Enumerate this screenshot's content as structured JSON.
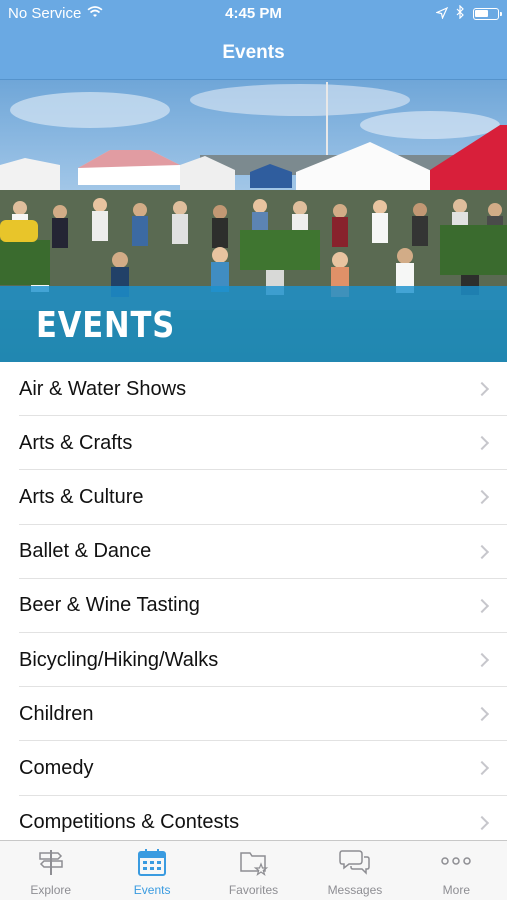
{
  "status_bar": {
    "carrier": "No Service",
    "time": "4:45 PM"
  },
  "nav": {
    "title": "Events"
  },
  "hero": {
    "title": "EVENTS"
  },
  "list": {
    "items": [
      {
        "label": "Air & Water Shows"
      },
      {
        "label": "Arts & Crafts"
      },
      {
        "label": "Arts & Culture"
      },
      {
        "label": "Ballet & Dance"
      },
      {
        "label": "Beer & Wine Tasting"
      },
      {
        "label": "Bicycling/Hiking/Walks"
      },
      {
        "label": "Children"
      },
      {
        "label": "Comedy"
      },
      {
        "label": "Competitions & Contests"
      }
    ]
  },
  "tab_bar": {
    "tabs": [
      {
        "label": "Explore",
        "icon": "signpost-icon",
        "active": false
      },
      {
        "label": "Events",
        "icon": "calendar-icon",
        "active": true
      },
      {
        "label": "Favorites",
        "icon": "folder-star-icon",
        "active": false
      },
      {
        "label": "Messages",
        "icon": "chat-bubbles-icon",
        "active": false
      },
      {
        "label": "More",
        "icon": "more-dots-icon",
        "active": false
      }
    ]
  },
  "colors": {
    "nav_background": "#6aa9e3",
    "hero_band": "#1b91cd",
    "tab_active": "#3a9be0",
    "tab_inactive": "#8e8e93"
  }
}
